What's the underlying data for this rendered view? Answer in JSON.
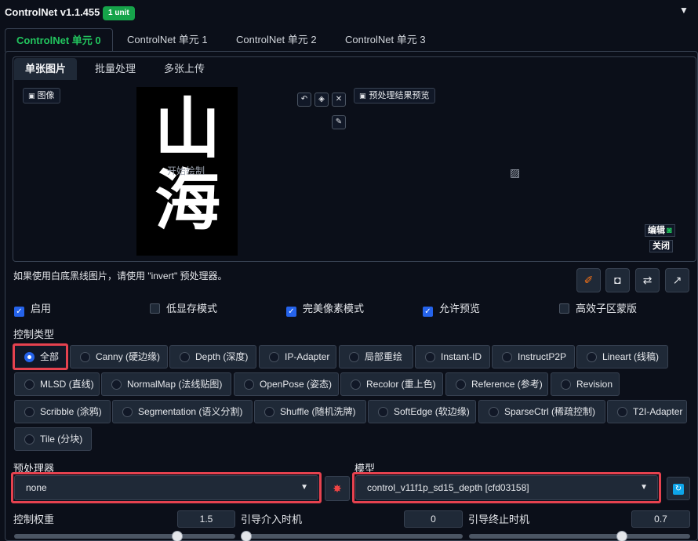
{
  "header": {
    "title": "ControlNet v1.1.455",
    "badge": "1 unit"
  },
  "unit_tabs": [
    {
      "label": "ControlNet 单元 0",
      "active": true
    },
    {
      "label": "ControlNet 单元 1",
      "active": false
    },
    {
      "label": "ControlNet 单元 2",
      "active": false
    },
    {
      "label": "ControlNet 单元 3",
      "active": false
    }
  ],
  "input_tabs": [
    {
      "label": "单张图片",
      "active": true
    },
    {
      "label": "批量处理",
      "active": false
    },
    {
      "label": "多张上传",
      "active": false
    }
  ],
  "image_area": {
    "image_label": "图像",
    "canvas_calligraphy": "山海",
    "canvas_overlay": "开始绘制",
    "preview_label": "预处理结果预览",
    "edit_label": "编辑",
    "close_label": "关闭"
  },
  "hint": "如果使用白底黑线图片，请使用 \"invert\" 预处理器。",
  "options": {
    "enable": {
      "label": "启用",
      "checked": true
    },
    "low_vram": {
      "label": "低显存模式",
      "checked": false
    },
    "pixel_perfect": {
      "label": "完美像素模式",
      "checked": true
    },
    "allow_preview": {
      "label": "允许预览",
      "checked": true
    },
    "efficient_sub": {
      "label": "高效子区蒙版",
      "checked": false
    }
  },
  "control_type": {
    "label": "控制类型",
    "selected": "全部",
    "items": [
      "全部",
      "Canny (硬边缘)",
      "Depth (深度)",
      "IP-Adapter",
      "局部重绘",
      "Instant-ID",
      "InstructP2P",
      "Lineart (线稿)",
      "MLSD (直线)",
      "NormalMap (法线贴图)",
      "OpenPose (姿态)",
      "Recolor (重上色)",
      "Reference (参考)",
      "Revision",
      "Scribble (涂鸦)",
      "Segmentation (语义分割)",
      "Shuffle (随机洗牌)",
      "SoftEdge (软边缘)",
      "SparseCtrl (稀疏控制)",
      "T2I-Adapter",
      "Tile (分块)"
    ]
  },
  "preprocessor": {
    "label": "预处理器",
    "value": "none"
  },
  "model": {
    "label": "模型",
    "value": "control_v11f1p_sd15_depth [cfd03158]"
  },
  "sliders": {
    "weight": {
      "label": "控制权重",
      "value": "1.5",
      "fraction": 0.75
    },
    "start": {
      "label": "引导介入时机",
      "value": "0",
      "fraction": 0.0
    },
    "end": {
      "label": "引导终止时机",
      "value": "0.7",
      "fraction": 0.7
    }
  },
  "colors": {
    "accent_green": "#22c55e",
    "badge_green": "#16a34a",
    "highlight_red": "#e6424f",
    "checkbox_blue": "#2563eb"
  }
}
